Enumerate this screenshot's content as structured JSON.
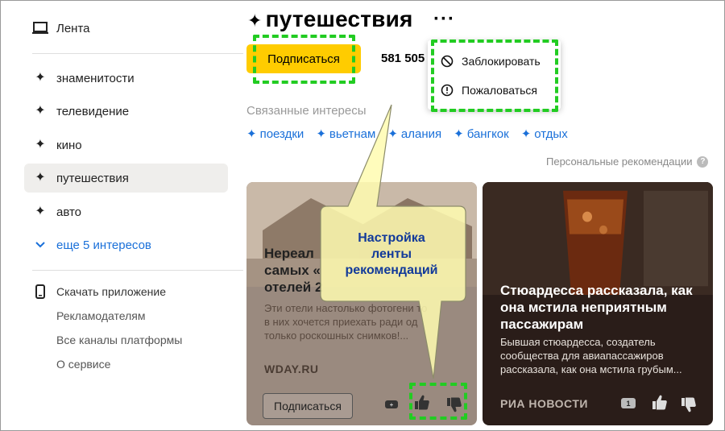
{
  "sidebar": {
    "feed": "Лента",
    "interests": [
      {
        "label": "знаменитости"
      },
      {
        "label": "телевидение"
      },
      {
        "label": "кино"
      },
      {
        "label": "путешествия"
      },
      {
        "label": "авто"
      }
    ],
    "more": "еще 5 интересов",
    "download": "Скачать приложение",
    "advertisers": "Рекламодателям",
    "channels": "Все каналы платформы",
    "about": "О сервисе"
  },
  "header": {
    "title": "путешествия",
    "subscribe": "Подписаться",
    "subscribers": "581 505 п"
  },
  "menu": {
    "block": "Заблокировать",
    "report": "Пожаловаться"
  },
  "related": {
    "label": "Связанные интересы",
    "tags": [
      "поездки",
      "вьетнам",
      "алания",
      "бангкок",
      "отдых"
    ]
  },
  "personal_label": "Персональные рекомендации",
  "cards": [
    {
      "title_lines": [
        "Нереал",
        "самых «",
        "отелей 2"
      ],
      "text_lines": [
        "Эти отели настолько фотогени то",
        "в них хочется приехать ради од",
        "только роскошных снимков!..."
      ],
      "source": "WDAY.RU",
      "button": "Подписаться"
    },
    {
      "title_lines": [
        "Стюардесса рассказала, как",
        "она мстила неприятным",
        "пассажирам"
      ],
      "text_lines": [
        "Бывшая стюардесса, создатель",
        "сообщества для авиапассажиров",
        "рассказала, как она мстила грубым..."
      ],
      "source": "РИА НОВОСТИ",
      "likes": "1"
    }
  ],
  "callout": {
    "lines": [
      "Настройка",
      "ленты",
      "рекомендаций"
    ]
  }
}
